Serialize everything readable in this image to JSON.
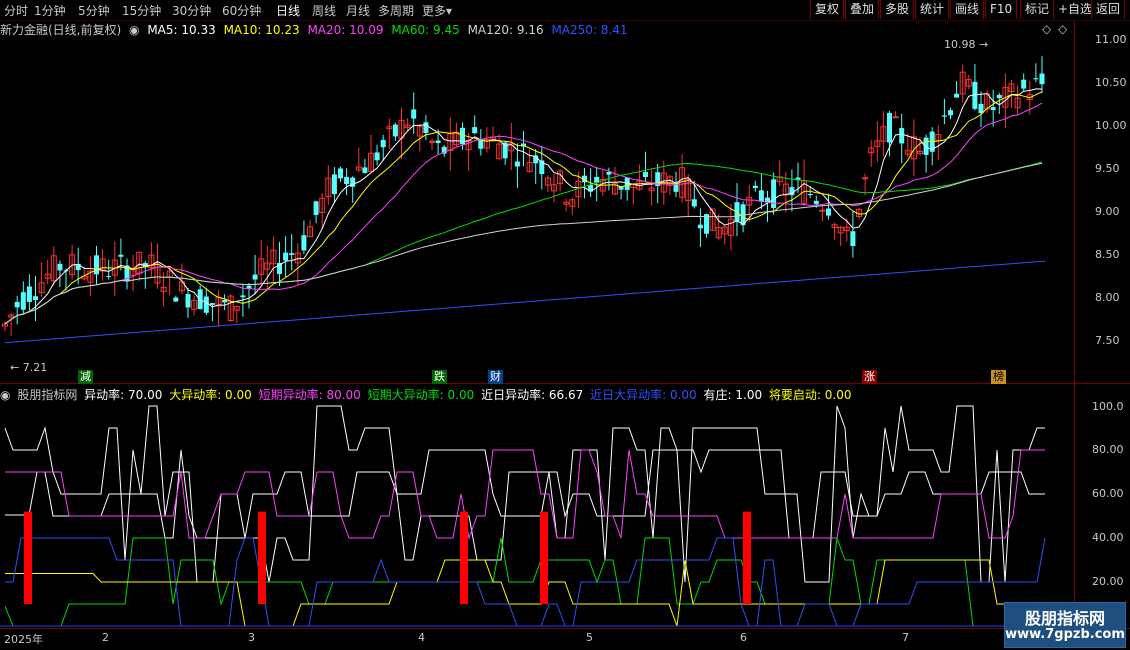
{
  "toolbar": {
    "periods": [
      "分时",
      "1分钟",
      "5分钟",
      "15分钟",
      "30分钟",
      "60分钟",
      "日线",
      "周线",
      "月线",
      "多周期",
      "更多"
    ],
    "active_period": "日线",
    "more_arrow": "▾",
    "buttons": [
      "复权",
      "叠加",
      "多股",
      "统计",
      "画线",
      "F10",
      "标记",
      "+自选",
      "返回"
    ]
  },
  "stock": {
    "title": "新力金融(日线,前复权)"
  },
  "ma_legend": [
    {
      "label": "MA5: 10.33",
      "color": "#ffffff"
    },
    {
      "label": "MA10: 10.23",
      "color": "#ffff00"
    },
    {
      "label": "MA20: 10.09",
      "color": "#ff40ff"
    },
    {
      "label": "MA60: 9.45",
      "color": "#00dd00"
    },
    {
      "label": "MA120: 9.16",
      "color": "#d0d0d0"
    },
    {
      "label": "MA250: 8.41",
      "color": "#3050ff"
    }
  ],
  "price_axis": [
    "11.00",
    "10.50",
    "10.00",
    "9.50",
    "9.00",
    "8.50",
    "8.00",
    "7.50"
  ],
  "price_annotations": {
    "high": "10.98",
    "low": "7.21"
  },
  "event_tags": [
    {
      "text": "减",
      "color": "#ffffff",
      "bg": "#006600"
    },
    {
      "text": "跌",
      "color": "#ffffff",
      "bg": "#006600"
    },
    {
      "text": "财",
      "color": "#ffffff",
      "bg": "#004488"
    },
    {
      "text": "涨",
      "color": "#ffffff",
      "bg": "#880000"
    },
    {
      "text": "榜",
      "color": "#000000",
      "bg": "#c89020"
    }
  ],
  "indicator": {
    "name": "股朋指标网",
    "items": [
      {
        "label": "异动率: 70.00",
        "color": "#ffffff"
      },
      {
        "label": "大异动率: 0.00",
        "color": "#ffff00"
      },
      {
        "label": "短期异动率: 80.00",
        "color": "#ff40ff"
      },
      {
        "label": "短期大异动率: 0.00",
        "color": "#00dd00"
      },
      {
        "label": "近日异动率: 66.67",
        "color": "#ffffff"
      },
      {
        "label": "近日大异动率: 0.00",
        "color": "#3050ff"
      },
      {
        "label": "有庄: 1.00",
        "color": "#ffffff"
      },
      {
        "label": "将要启动: 0.00",
        "color": "#ffff00"
      }
    ]
  },
  "indicator_axis": [
    "100.0",
    "80.00",
    "60.00",
    "40.00",
    "20.00"
  ],
  "date_axis": [
    "2025年",
    "2",
    "3",
    "4",
    "5",
    "6",
    "7"
  ],
  "watermark": {
    "title": "股朋指标网",
    "url": "www.7gpzb.com"
  },
  "colors": {
    "up": "#ff3030",
    "down": "#54ffff",
    "frame": "#7a0000"
  }
}
